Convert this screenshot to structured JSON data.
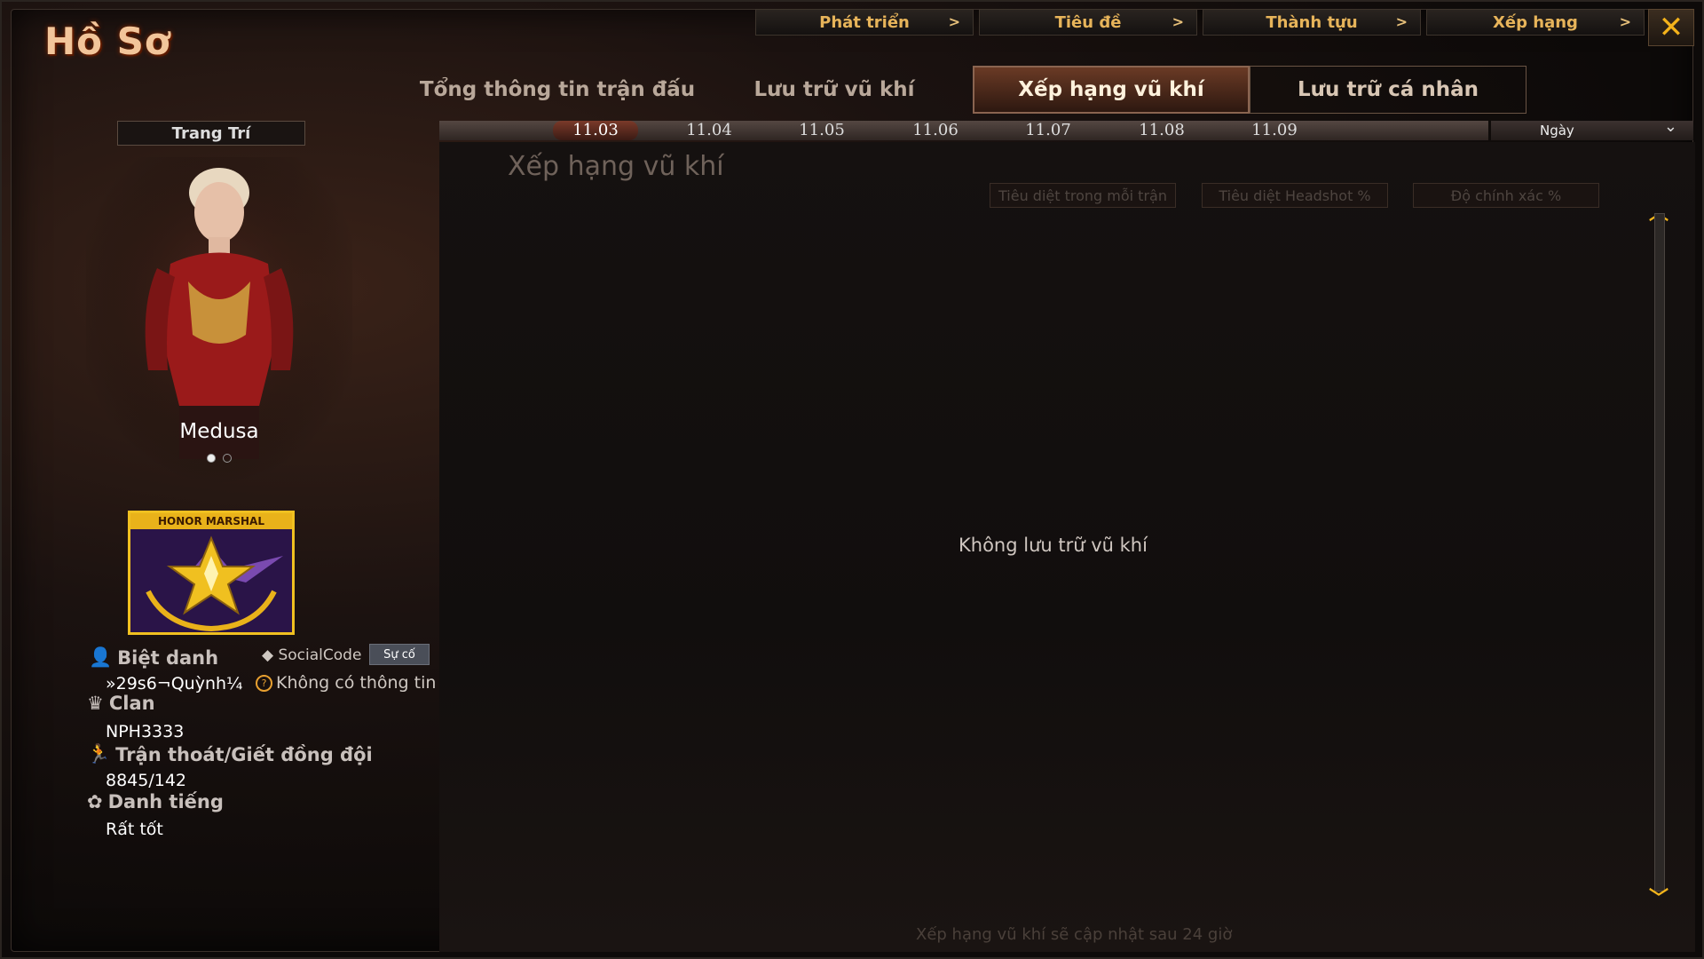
{
  "window": {
    "title": "Hồ Sơ",
    "close_icon": "close-icon"
  },
  "top_nav": [
    {
      "label": "Phát triển",
      "arrow": ">"
    },
    {
      "label": "Tiêu đề",
      "arrow": ">"
    },
    {
      "label": "Thành tựu",
      "arrow": ">"
    },
    {
      "label": "Xếp hạng",
      "arrow": ">"
    }
  ],
  "tabs": [
    {
      "label": "Tổng thông tin trận đấu",
      "active": false
    },
    {
      "label": "Lưu trữ vũ khí",
      "active": false
    },
    {
      "label": "Xếp hạng vũ khí",
      "active": true
    },
    {
      "label": "Lưu trữ cá nhân",
      "active": false
    }
  ],
  "dates": [
    "11.03",
    "11.04",
    "11.05",
    "11.06",
    "11.07",
    "11.08",
    "11.09"
  ],
  "selected_date": "11.03",
  "period_select": {
    "value": "Ngày",
    "icon": "chevron-down-icon"
  },
  "panel": {
    "heading": "Xếp hạng vũ khí",
    "columns": [
      "Tiêu diệt trong mỗi trận",
      "Tiêu diệt Headshot %",
      "Độ chính xác %"
    ],
    "empty_message": "Không lưu trữ vũ khí",
    "footer_note": "Xếp hạng vũ khí sẽ cập nhật sau 24 giờ"
  },
  "profile": {
    "decor_button": "Trang Trí",
    "character_name": "Medusa",
    "badge_text": "HONOR MARSHAL",
    "nickname_label": "Biệt danh",
    "nickname_value": "»29s6¬Quỳnh¼",
    "social_label": "SocialCode",
    "social_button": "Sự cố",
    "social_value": "Không có thông tin",
    "clan_label": "Clan",
    "clan_value": "NPH3333",
    "escape_label": "Trận thoát/Giết đồng đội",
    "escape_value": "8845/142",
    "reputation_label": "Danh tiếng",
    "reputation_value": "Rất tốt"
  },
  "colors": {
    "accent": "#f3b21b",
    "tab_active": "#6a3a25",
    "nav_text": "#e7b45a"
  }
}
